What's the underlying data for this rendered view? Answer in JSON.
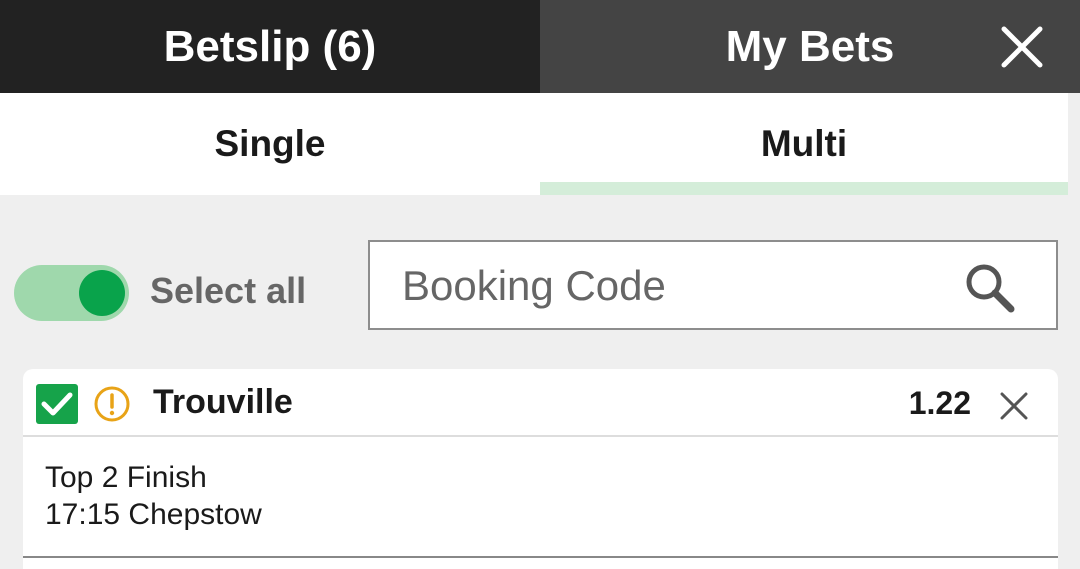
{
  "header": {
    "betslip_tab": "Betslip (6)",
    "mybets_tab": "My Bets",
    "close_icon": "close-icon"
  },
  "subtabs": {
    "single": "Single",
    "multi": "Multi",
    "active": "multi"
  },
  "controls": {
    "select_all_label": "Select all",
    "select_all_on": true,
    "booking_placeholder": "Booking Code",
    "booking_value": ""
  },
  "selection": {
    "checked": true,
    "name": "Trouville",
    "odds": "1.22",
    "market": "Top 2 Finish",
    "event": "17:15 Chepstow"
  },
  "colors": {
    "header_dark": "#222222",
    "header_mid": "#444444",
    "accent_green": "#09a34b",
    "checkbox_green": "#16a34a",
    "warning_orange": "#e8a317",
    "tab_indicator": "#d4edd9"
  }
}
